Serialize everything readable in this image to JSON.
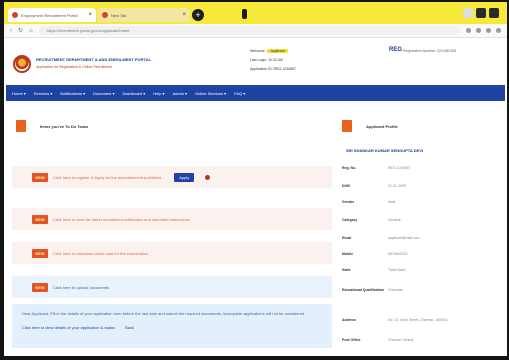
{
  "browser": {
    "tabs": [
      {
        "label": "Employment Recruitment Portal"
      },
      {
        "label": "New Tab"
      }
    ],
    "new_tab_label": "+",
    "url": "https://recruitment.portal.gov.in/applicant/home"
  },
  "header": {
    "org_name": "RECRUITMENT DEPARTMENT & AND ENROLMENT PORTAL",
    "org_subtitle": "Application for Registration & Online Recruitment",
    "welcome_label": "Welcome :",
    "welcome_user": "Applicant",
    "mid_line2": "Last Login: 10:32 AM",
    "mid_line3": "Application ID: REG-1234567",
    "badge": "REG",
    "right_text": "Registration Number: 3210987654"
  },
  "nav": {
    "items": [
      "Home ▾",
      "Services ▾",
      "Notifications ▾",
      "Document ▾",
      "Dashboard ▾",
      "Help ▾",
      "Admin ▾",
      "Online Services ▾",
      "FAQ ▾"
    ]
  },
  "left": {
    "title": "Items you've To Do Tasks",
    "rows": [
      {
        "badge": "NEW",
        "text": "Click here to register & Apply for the advertisement published",
        "button": "Apply"
      },
      {
        "badge": "NEW",
        "text": "Click here to view the latest recruitment notification and important instructions"
      },
      {
        "badge": "NEW",
        "text": "Click here to download admit card for the examination"
      },
      {
        "badge": "NEW",
        "text": "Click here to upload documents"
      }
    ],
    "notice_text": "Dear Applicant, Fill in the details of your application form before the last date and submit the required documents; incomplete applications will not be considered.",
    "notice_link": "Click here to view details of your application & status",
    "notice_link2": "Back"
  },
  "right": {
    "title": "Applicant Profile",
    "subtitle": "SRI SHANKAR KUMAR SENGUPTA DEVI",
    "fields": [
      {
        "k": "Reg. No.",
        "v": "REG-1234567"
      },
      {
        "k": "DOB",
        "v": "01-01-1995"
      },
      {
        "k": "Gender",
        "v": "Male"
      },
      {
        "k": "Category",
        "v": "General"
      },
      {
        "k": "Email",
        "v": "applicant@mail.com"
      },
      {
        "k": "Mobile",
        "v": "9876543210"
      },
      {
        "k": "State",
        "v": "Tamil Nadu"
      },
      {
        "k": "Educational Qualification",
        "v": "Graduate"
      },
      {
        "k": "Address",
        "v": "No. 12, Main Street, Chennai - 600001"
      },
      {
        "k": "Post Office",
        "v": "Chennai Central"
      }
    ]
  },
  "colors": {
    "tabbar": "#f7e93a",
    "nav": "#1f43a3",
    "badge": "#e0552a"
  }
}
